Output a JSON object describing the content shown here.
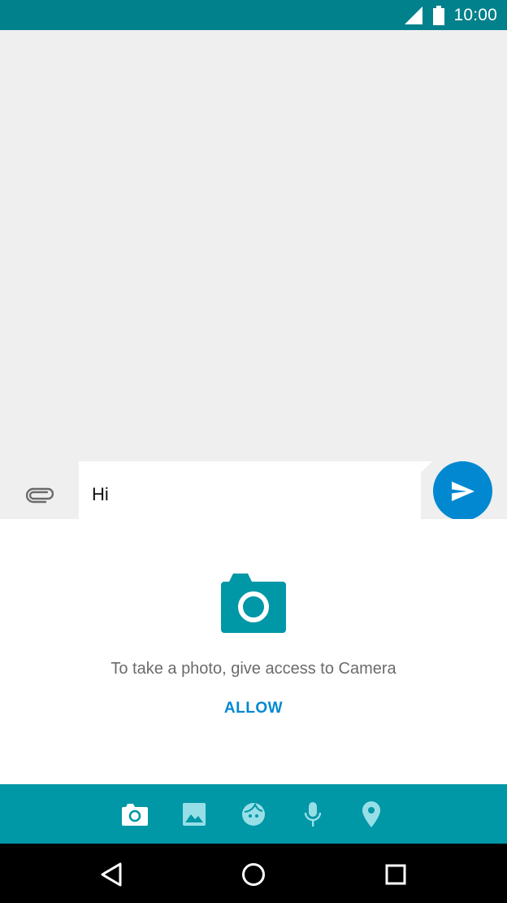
{
  "status_bar": {
    "time": "10:00",
    "icons": [
      "signal-icon",
      "battery-icon"
    ]
  },
  "composer": {
    "attach_icon": "paperclip-icon",
    "message_value": "Hi",
    "send_icon": "send-icon"
  },
  "media_panel": {
    "camera_icon": "camera-icon",
    "permission_text": "To take a photo, give access to Camera",
    "allow_label": "ALLOW"
  },
  "attach_toolbar": {
    "items": [
      "camera-icon",
      "gallery-icon",
      "sticker-icon",
      "mic-icon",
      "location-icon"
    ],
    "selected": "camera-icon"
  },
  "nav_bar": {
    "items": [
      "back-icon",
      "home-icon",
      "recents-icon"
    ]
  },
  "colors": {
    "status_bar": "#00818b",
    "accent": "#0288d1",
    "toolbar": "#0097a7",
    "camera_tile": "#0097a7"
  }
}
